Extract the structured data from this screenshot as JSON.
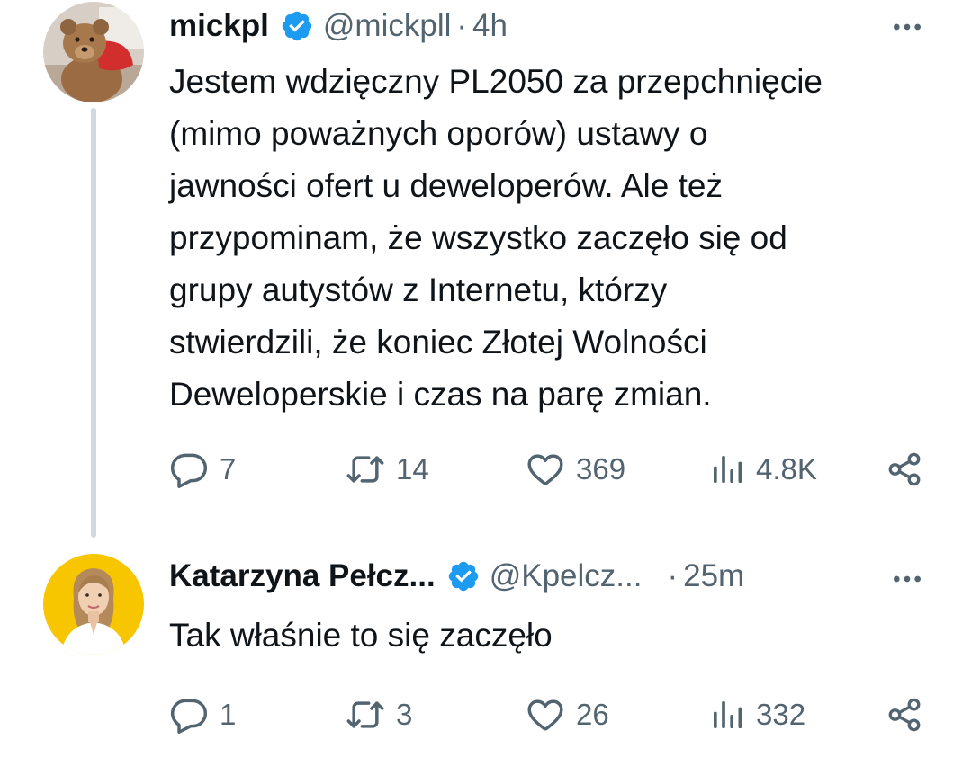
{
  "tweets": [
    {
      "author_name": "mickpl",
      "handle": "@mickpll",
      "separator": "·",
      "time": "4h",
      "avatar_icon": "teddy-bear-avatar",
      "text_lines": [
        "Jestem wdzięczny PL2050 za przepchnięcie",
        "(mimo poważnych oporów) ustawy o",
        "jawności ofert u deweloperów. Ale też",
        "przypominam, że wszystko zaczęło się od",
        "grupy autystów z Internetu, którzy",
        "stwierdzili, że koniec Złotej Wolności",
        "Deweloperskie i czas na parę zmian."
      ],
      "replies": "7",
      "reposts": "14",
      "likes": "369",
      "views": "4.8K"
    },
    {
      "author_name": "Katarzyna Pełcz...",
      "handle": "@Kpelcz...",
      "separator": "·",
      "time": "25m",
      "avatar_icon": "woman-portrait-avatar",
      "text_lines": [
        "Tak właśnie to się zaczęło"
      ],
      "replies": "1",
      "reposts": "3",
      "likes": "26",
      "views": "332"
    }
  ],
  "colors": {
    "verified_badge": "#1d9bf0",
    "text_primary": "#0f1419",
    "text_secondary": "#536471",
    "thread_line": "#cfd9de",
    "avatar2_background": "#f7c600"
  }
}
